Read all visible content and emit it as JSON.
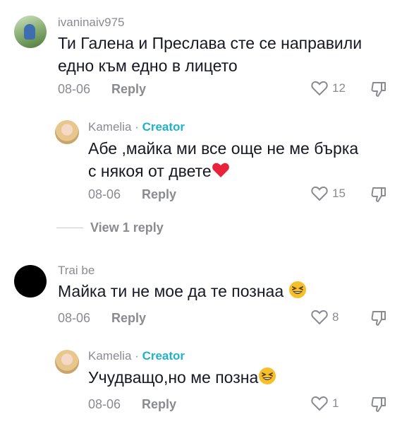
{
  "comments": [
    {
      "username": "ivaninaiv975",
      "text_line1": "Ти Галена и Преслава сте се направили",
      "text_line2": "едно към едно в лицето",
      "date": "08-06",
      "reply_label": "Reply",
      "likes": "12"
    },
    {
      "username": "Kamelia",
      "separator": "·",
      "badge": "Creator",
      "text_line1": "Абе ,майка ми все още не ме бърка",
      "text_line2": "с някоя от двете",
      "date": "08-06",
      "reply_label": "Reply",
      "likes": "15"
    },
    {
      "username": "Trai be",
      "text_line1": "Майка ти не мое да те познаа",
      "date": "08-06",
      "reply_label": "Reply",
      "likes": "8"
    },
    {
      "username": "Kamelia",
      "separator": "·",
      "badge": "Creator",
      "text_line1": "Учудващо,но ме позна",
      "date": "08-06",
      "reply_label": "Reply",
      "likes": "1"
    }
  ],
  "view_replies_label": "View 1 reply",
  "colors": {
    "creator_badge": "#20b2c8",
    "muted": "#8a8b91",
    "heart_emoji": "#e8223a",
    "smile_emoji": "#f5c02b"
  }
}
